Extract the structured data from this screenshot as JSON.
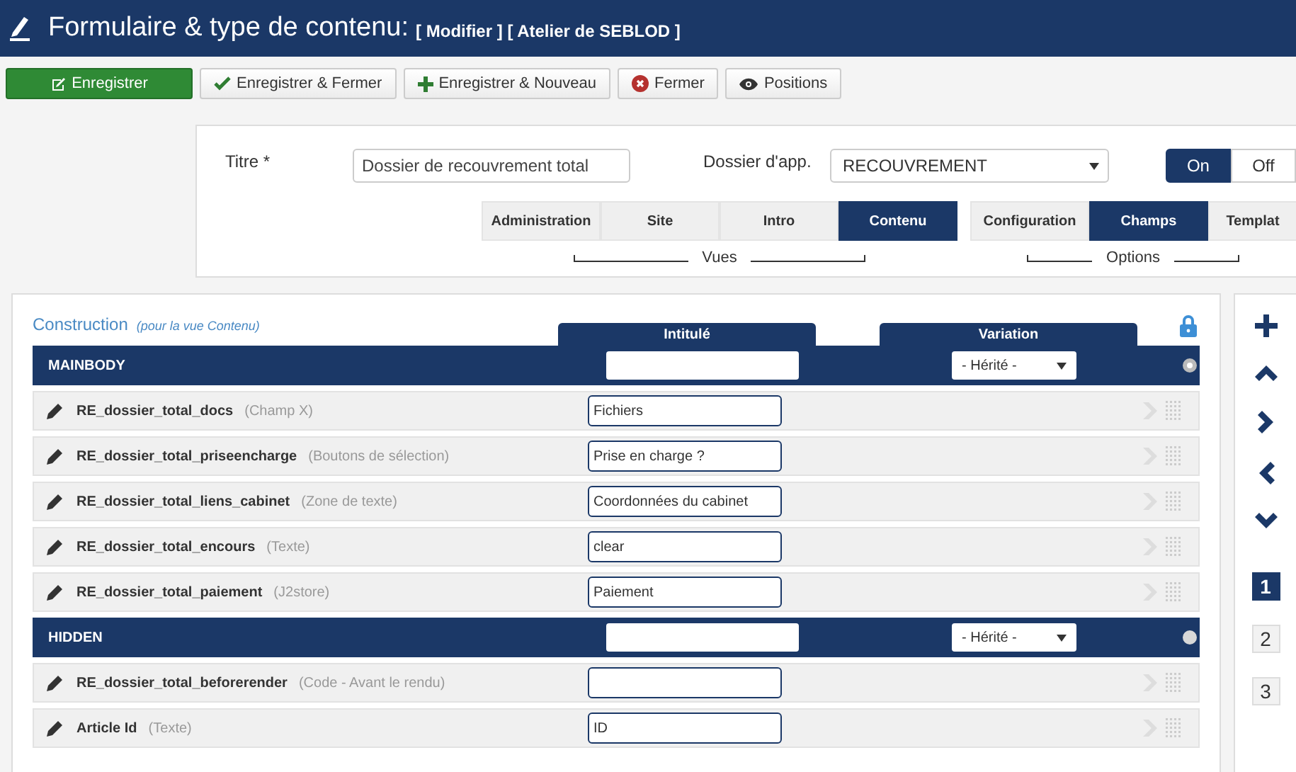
{
  "header": {
    "title": "Formulaire & type de contenu:",
    "subtitle": "[ Modifier ] [ Atelier de SEBLOD ]"
  },
  "toolbar": [
    {
      "label": "Enregistrer",
      "kind": "save"
    },
    {
      "label": "Enregistrer & Fermer",
      "kind": "check"
    },
    {
      "label": "Enregistrer & Nouveau",
      "kind": "plus"
    },
    {
      "label": "Fermer",
      "kind": "close"
    },
    {
      "label": "Positions",
      "kind": "eye"
    }
  ],
  "form": {
    "title_label": "Titre *",
    "title_value": "Dossier de recouvrement total",
    "folder_label": "Dossier d'app.",
    "folder_value": "RECOUVREMENT",
    "toggle": [
      {
        "label": "On",
        "selected": true
      },
      {
        "label": "Off",
        "selected": false
      }
    ],
    "views": {
      "caption": "Vues",
      "tabs": [
        {
          "label": "Administration",
          "selected": false
        },
        {
          "label": "Site",
          "selected": false
        },
        {
          "label": "Intro",
          "selected": false
        },
        {
          "label": "Contenu",
          "selected": true
        }
      ]
    },
    "options": {
      "caption": "Options",
      "tabs": [
        {
          "label": "Configuration",
          "selected": false
        },
        {
          "label": "Champs",
          "selected": true
        },
        {
          "label": "Templat",
          "selected": false
        }
      ]
    }
  },
  "construction": {
    "title": "Construction",
    "subtitle": "(pour la vue Contenu)",
    "columns": [
      "Intitulé",
      "Variation"
    ],
    "sections": [
      {
        "title": "MAINBODY",
        "variation": "- Hérité -",
        "selected": true,
        "rows": [
          {
            "name": "RE_dossier_total_docs",
            "type": "(Champ X)",
            "label": "Fichiers"
          },
          {
            "name": "RE_dossier_total_priseencharge",
            "type": "(Boutons de sélection)",
            "label": "Prise en charge ?"
          },
          {
            "name": "RE_dossier_total_liens_cabinet",
            "type": "(Zone de texte)",
            "label": "Coordonnées du cabinet"
          },
          {
            "name": "RE_dossier_total_encours",
            "type": "(Texte)",
            "label": "clear"
          },
          {
            "name": "RE_dossier_total_paiement",
            "type": "(J2store)",
            "label": "Paiement"
          }
        ]
      },
      {
        "title": "HIDDEN",
        "variation": "- Hérité -",
        "selected": false,
        "rows": [
          {
            "name": "RE_dossier_total_beforerender",
            "type": "(Code - Avant le rendu)",
            "label": ""
          },
          {
            "name": "Article Id",
            "type": "(Texte)",
            "label": "ID"
          }
        ]
      }
    ]
  },
  "sidebar": {
    "pages": [
      {
        "label": "1",
        "selected": true
      },
      {
        "label": "2",
        "selected": false
      },
      {
        "label": "3",
        "selected": false
      }
    ]
  }
}
